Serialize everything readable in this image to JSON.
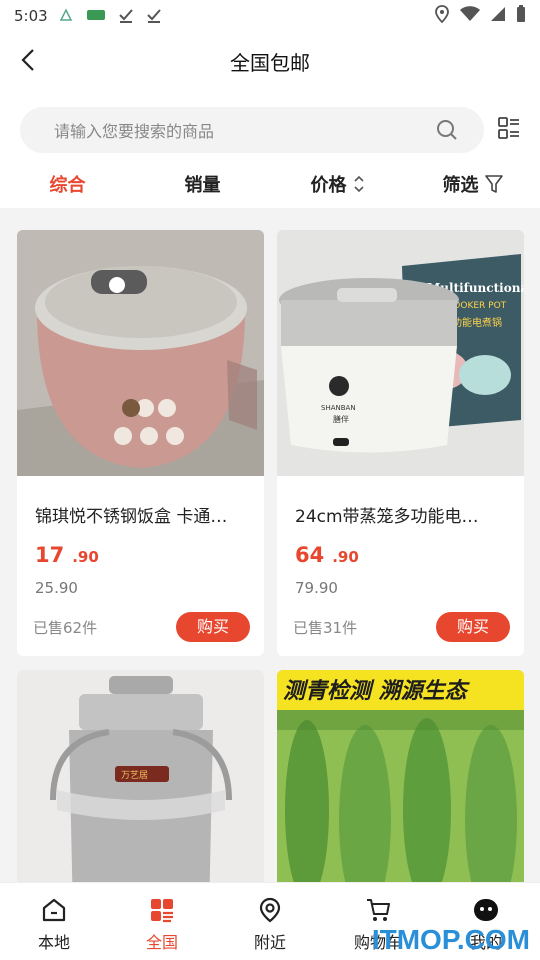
{
  "status_bar": {
    "time": "5:03"
  },
  "header": {
    "title": "全国包邮"
  },
  "search": {
    "placeholder": "请输入您要搜索的商品"
  },
  "sort_tabs": [
    {
      "label": "综合",
      "active": true
    },
    {
      "label": "销量"
    },
    {
      "label": "价格"
    },
    {
      "label": "筛选"
    }
  ],
  "products": [
    {
      "name": "锦琪悦不锈钢饭盒 卡通…",
      "price_int": "17",
      "price_dec": ".90",
      "original_price": "25.90",
      "sold": "已售62件",
      "buy_label": "购买"
    },
    {
      "name": "24cm带蒸笼多功能电…",
      "price_int": "64",
      "price_dec": ".90",
      "original_price": "79.90",
      "sold": "已售31件",
      "buy_label": "购买",
      "image_text": {
        "line1": "Multifunctional",
        "line2": "COOKER POT",
        "line3": "多功能电煮锅",
        "brand": "SHANBAN",
        "brand_cn": "膳伴"
      }
    },
    {
      "name": "",
      "image_text": {
        "label": "万艺居"
      }
    },
    {
      "name": "",
      "image_text": {
        "banner": "测青检测 溯源生态"
      }
    }
  ],
  "tab_bar": [
    {
      "label": "本地",
      "icon": "home-icon"
    },
    {
      "label": "全国",
      "icon": "grid-icon",
      "active": true
    },
    {
      "label": "附近",
      "icon": "location-icon"
    },
    {
      "label": "购物车",
      "icon": "cart-icon"
    },
    {
      "label": "我的",
      "icon": "profile-icon"
    }
  ],
  "watermark": "ITMOP.COM",
  "colors": {
    "accent": "#e8472f",
    "background": "#f3f3f3",
    "watermark": "#2a8fd9"
  }
}
